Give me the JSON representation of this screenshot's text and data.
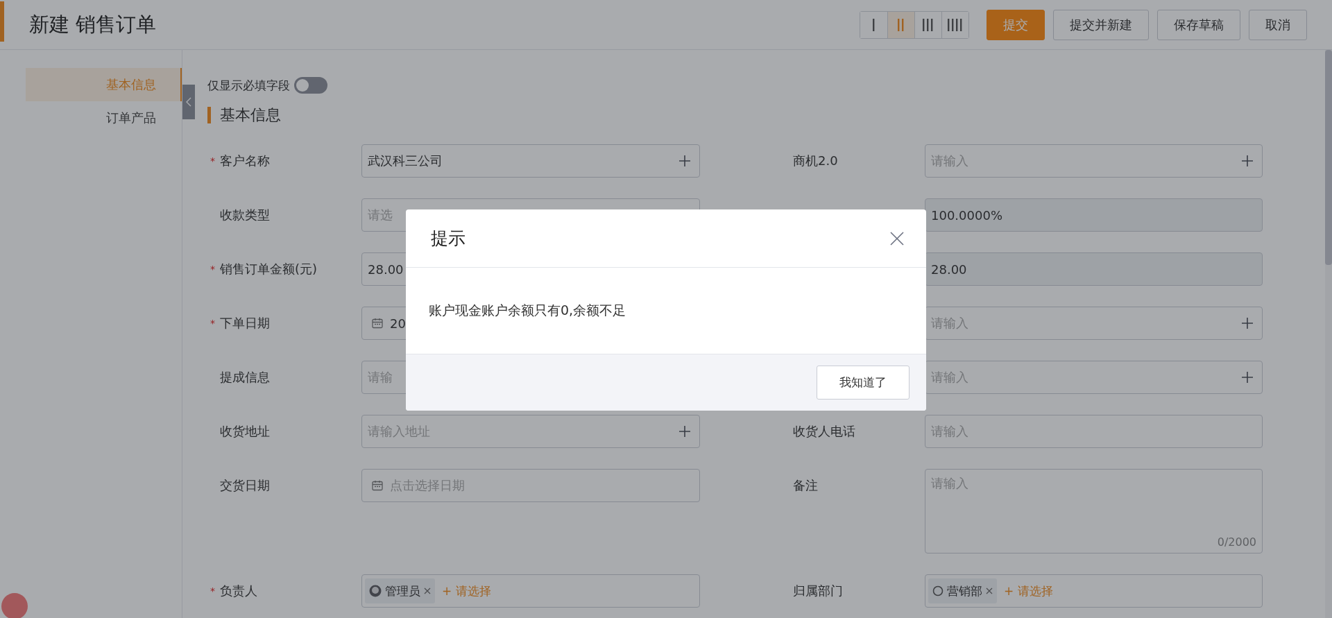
{
  "header": {
    "title": "新建 销售订单",
    "layout_options": [
      {
        "selected": false
      },
      {
        "selected": true
      },
      {
        "selected": false
      },
      {
        "selected": false
      }
    ],
    "buttons": [
      {
        "label": "提交",
        "kind": "primary"
      },
      {
        "label": "提交并新建",
        "kind": "default"
      },
      {
        "label": "保存草稿",
        "kind": "default"
      },
      {
        "label": "取消",
        "kind": "default"
      }
    ]
  },
  "sidebar": {
    "items": [
      {
        "label": "基本信息",
        "selected": true
      },
      {
        "label": "订单产品",
        "selected": false
      }
    ]
  },
  "required_only_toggle": {
    "label": "仅显示必填字段",
    "on": false
  },
  "section": {
    "title": "基本信息"
  },
  "fields": [
    {
      "label": "客户名称",
      "required_mark": "*",
      "kind": "lookup",
      "value": "武汉科三公司"
    },
    {
      "label": "商机2.0",
      "kind": "lookup",
      "placeholder": "请输入"
    },
    {
      "label": "收款类型",
      "kind": "text",
      "placeholder": "请选"
    },
    {
      "kind": "readonly",
      "value": "100.0000%"
    },
    {
      "label": "销售订单金额(元)",
      "required_mark": "*",
      "kind": "text",
      "value": "28.00"
    },
    {
      "kind": "readonly",
      "value": "28.00"
    },
    {
      "label": "下单日期",
      "required_mark": "*",
      "kind": "date",
      "value": "20"
    },
    {
      "kind": "lookup",
      "placeholder": "请输入"
    },
    {
      "label": "提成信息",
      "kind": "text",
      "placeholder": "请输"
    },
    {
      "kind": "lookup",
      "placeholder": "请输入"
    },
    {
      "label": "收货地址",
      "kind": "lookup",
      "placeholder": "请输入地址"
    },
    {
      "label": "收货人电话",
      "kind": "text",
      "placeholder": "请输入"
    },
    {
      "label": "交货日期",
      "kind": "date",
      "placeholder": "点击选择日期"
    },
    {
      "label": "备注",
      "kind": "textarea",
      "placeholder": "请输入",
      "counter": "0/2000"
    },
    {
      "label": "负责人",
      "required_mark": "*",
      "kind": "people",
      "tags": [
        {
          "label": "管理员",
          "kind": "user"
        }
      ],
      "add_label": "+ 请选择"
    },
    {
      "label": "归属部门",
      "kind": "people",
      "tags": [
        {
          "label": "营销部",
          "kind": "department"
        }
      ],
      "add_label": "+ 请选择"
    }
  ],
  "dialog": {
    "title": "提示",
    "message": "账户现金账户余额只有0,余额不足",
    "button": "我知道了"
  }
}
